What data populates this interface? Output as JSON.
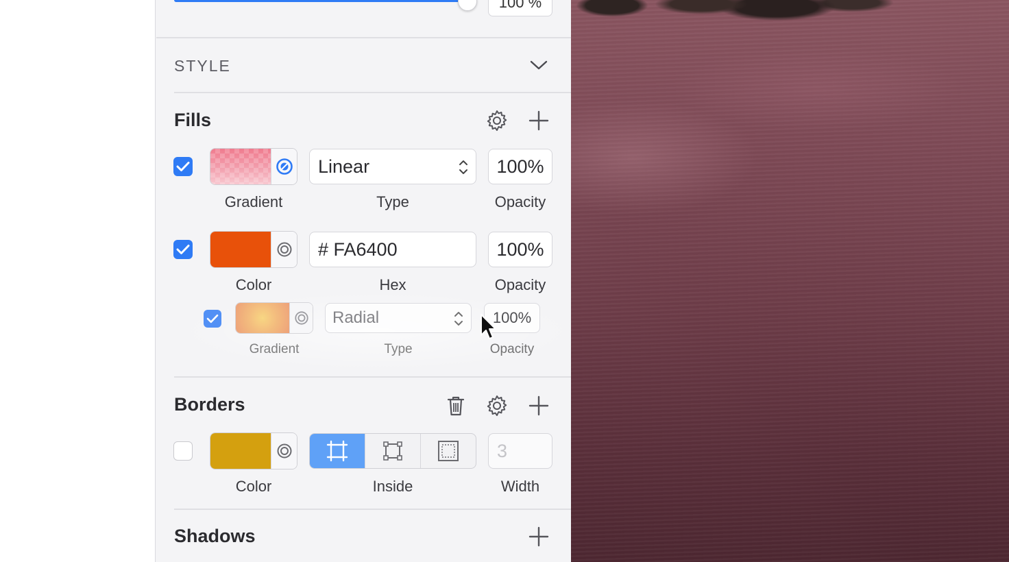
{
  "style_section": {
    "label": "STYLE"
  },
  "top_opacity": {
    "value": "100 %"
  },
  "fills": {
    "title": "Fills",
    "rows": [
      {
        "checked": true,
        "swatch_label": "Gradient",
        "type_value": "Linear",
        "type_label": "Type",
        "opacity_value": "100%",
        "opacity_label": "Opacity"
      },
      {
        "checked": true,
        "swatch_label": "Color",
        "hex_value": "# FA6400",
        "hex_label": "Hex",
        "opacity_value": "100%",
        "opacity_label": "Opacity",
        "color": "#e8510a"
      },
      {
        "checked": true,
        "swatch_label": "Gradient",
        "type_value": "Radial",
        "type_label": "Type",
        "opacity_value": "100%",
        "opacity_label": "Opacity",
        "dragging": true
      }
    ]
  },
  "borders": {
    "title": "Borders",
    "row": {
      "checked": false,
      "swatch_label": "Color",
      "color": "#d4a00f",
      "position_label": "Inside",
      "position_selected": "Inside",
      "width_value": "3",
      "width_label": "Width"
    }
  },
  "shadows": {
    "title": "Shadows"
  },
  "colors": {
    "accent": "#2f7bf5",
    "segment_selected": "#5fa1f7"
  },
  "icons": [
    "chevron-down-icon",
    "gear-icon",
    "plus-icon",
    "trash-icon",
    "blend-mode-icon",
    "stepper-icon",
    "checkmark-icon",
    "border-center-icon",
    "border-inside-icon",
    "border-outside-icon",
    "cursor-icon"
  ]
}
